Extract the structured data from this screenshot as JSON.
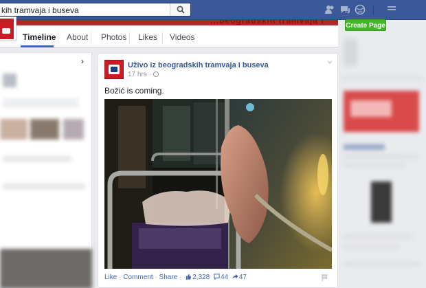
{
  "search": {
    "value": "kih tramvaja i buseva"
  },
  "cover": {
    "partial_title": "...beogradskih tramvaja i buseva"
  },
  "tabs": [
    {
      "label": "Timeline",
      "active": true
    },
    {
      "label": "About",
      "active": false
    },
    {
      "label": "Photos",
      "active": false
    },
    {
      "label": "Likes",
      "active": false
    },
    {
      "label": "Videos",
      "active": false
    }
  ],
  "create_page": "Create Page",
  "post": {
    "author": "Uživo iz beogradskih tramvaja i buseva",
    "time": "17 hrs ·",
    "text": "Božić is coming.",
    "actions": {
      "like": "Like",
      "comment": "Comment",
      "share": "Share",
      "dot": "·"
    },
    "stats": {
      "likes": "2,328",
      "comments": "44",
      "shares": "47"
    }
  },
  "colors": {
    "topbar": "#3b5998",
    "link": "#365899",
    "create": "#42b72a",
    "accent": "#4267b2"
  }
}
